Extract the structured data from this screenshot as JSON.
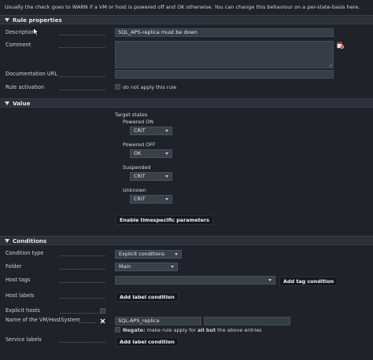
{
  "intro_text": "Usually the check goes to WARN if a VM or host is powered off and OK otherwise. You can change this behaviour on a per-state-basis here.",
  "rule_properties": {
    "title": "Rule properties",
    "description_label": "Description",
    "description_value": "SQL_APS-replica must be down",
    "comment_label": "Comment",
    "documentation_label": "Documentation URL",
    "activation_label": "Rule activation",
    "activation_checkbox_label": "do not apply this rule"
  },
  "value": {
    "title": "Value",
    "target_states_label": "Target states",
    "states": [
      {
        "label": "Powered ON",
        "selected": "CRIT"
      },
      {
        "label": "Powered OFF",
        "selected": "OK"
      },
      {
        "label": "Suspended",
        "selected": "CRIT"
      },
      {
        "label": "Unknown",
        "selected": "CRIT"
      }
    ],
    "timespecific_button": "Enable timespecific parameters"
  },
  "conditions": {
    "title": "Conditions",
    "condition_type_label": "Condition type",
    "condition_type_value": "Explicit conditions",
    "folder_label": "Folder",
    "folder_value": "Main",
    "host_tags_label": "Host tags",
    "host_tags_value": "",
    "add_tag_button": "Add tag condition",
    "host_labels_label": "Host labels",
    "add_label_button": "Add label condition",
    "explicit_hosts_label": "Explicit hosts",
    "vm_name_label": "Name of the VM/HostSystem",
    "vm_name_value": "SQL-APS_replica",
    "vm_name_second_value": "",
    "negate_bold": "Negate:",
    "negate_text": "make rule apply for",
    "negate_bold2": "all but",
    "negate_text2": "the above entries",
    "service_labels_label": "Service labels",
    "add_service_label_button": "Add label condition"
  },
  "colors": {
    "background": "#1f2329",
    "section_header": "#2c3138",
    "input": "#373d45",
    "button": "#15181c"
  }
}
